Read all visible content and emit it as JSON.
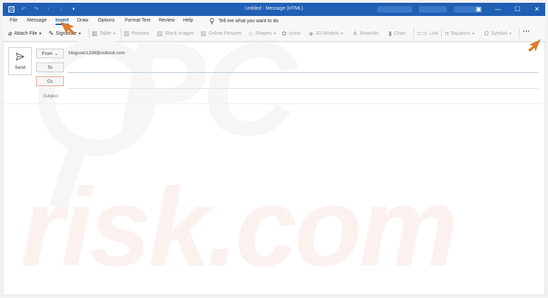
{
  "window": {
    "title": "Untitled  -  Message (HTML)",
    "quick_access": [
      "save-icon",
      "undo-icon",
      "redo-icon",
      "up-icon",
      "down-icon",
      "customize-icon"
    ],
    "controls": {
      "restore": "▣",
      "minimize": "—",
      "maximize": "☐",
      "close": "✕"
    }
  },
  "menu": {
    "items": [
      "File",
      "Message",
      "Insert",
      "Draw",
      "Options",
      "Format Text",
      "Review",
      "Help"
    ],
    "active": "Insert",
    "tell_me": "Tell me what you want to do"
  },
  "ribbon": {
    "attach_file": "Attach File",
    "signature": "Signature",
    "table": "Table",
    "pictures": "Pictures",
    "stock_images": "Stock Images",
    "online_pictures": "Online Pictures",
    "shapes": "Shapes",
    "icons": "Icons",
    "models_3d": "3D Models",
    "smartart": "SmartArt",
    "chart": "Chart",
    "link": "Link",
    "equation": "Equation",
    "symbol": "Symbol",
    "more": "···"
  },
  "compose": {
    "send_label": "Send",
    "from_label": "From",
    "from_value": "bloguser1338@outlook.com",
    "to_label": "To",
    "cc_label": "Cc",
    "subject_placeholder": "Subject"
  },
  "watermark": {
    "text1": "PC",
    "text2": "risk.com"
  },
  "colors": {
    "accent": "#1f5fb4",
    "annotation_arrow": "#e07b2e"
  }
}
